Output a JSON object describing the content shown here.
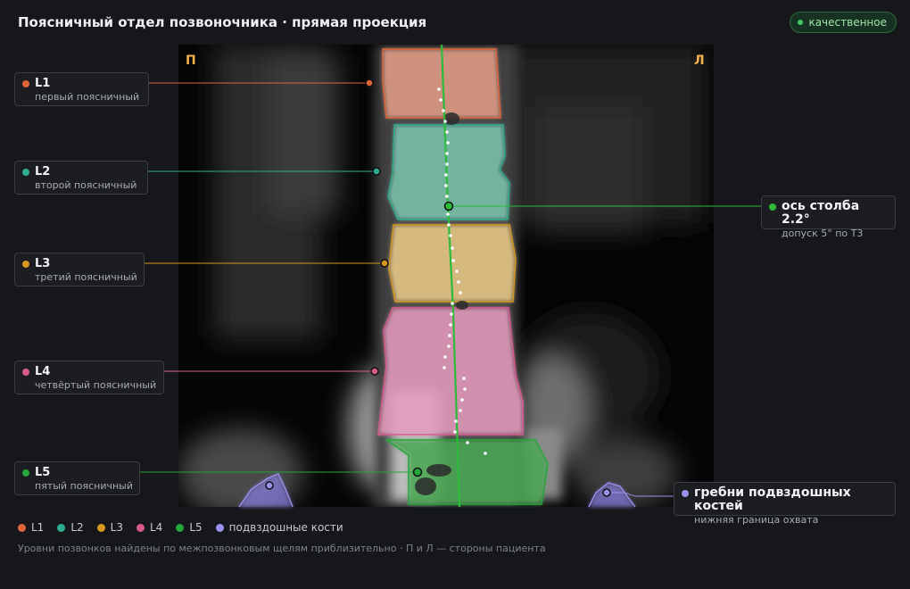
{
  "header": {
    "title": "Поясничный отдел позвоночника · прямая проекция",
    "quality_badge": "качественное"
  },
  "image": {
    "side_left_marker": "П",
    "side_right_marker": "Л"
  },
  "vertebrae": [
    {
      "id": "L1",
      "name": "L1",
      "description": "первый поясничный",
      "color": "#e0663a"
    },
    {
      "id": "L2",
      "name": "L2",
      "description": "второй поясничный",
      "color": "#2fae8f"
    },
    {
      "id": "L3",
      "name": "L3",
      "description": "третий поясничный",
      "color": "#d6981f"
    },
    {
      "id": "L4",
      "name": "L4",
      "description": "четвёртый поясничный",
      "color": "#d95b8e"
    },
    {
      "id": "L5",
      "name": "L5",
      "description": "пятый поясничный",
      "color": "#24a63a"
    }
  ],
  "axis": {
    "label": "ось столба 2.2°",
    "tolerance": "допуск 5° по Т3",
    "color": "#2dbb3a"
  },
  "iliac": {
    "label": "гребни подвздошных костей",
    "description": "нижняя граница охвата",
    "color": "#9a92ef"
  },
  "legend": [
    {
      "label": "L1",
      "color": "#e0663a"
    },
    {
      "label": "L2",
      "color": "#2fae8f"
    },
    {
      "label": "L3",
      "color": "#d6981f"
    },
    {
      "label": "L4",
      "color": "#d95b8e"
    },
    {
      "label": "L5",
      "color": "#24a63a"
    },
    {
      "label": "подвздошные кости",
      "color": "#9a92ef"
    }
  ],
  "footnote": "Уровни позвонков найдены по межпозвонковым щелям приблизительно · П и Л — стороны пациента"
}
